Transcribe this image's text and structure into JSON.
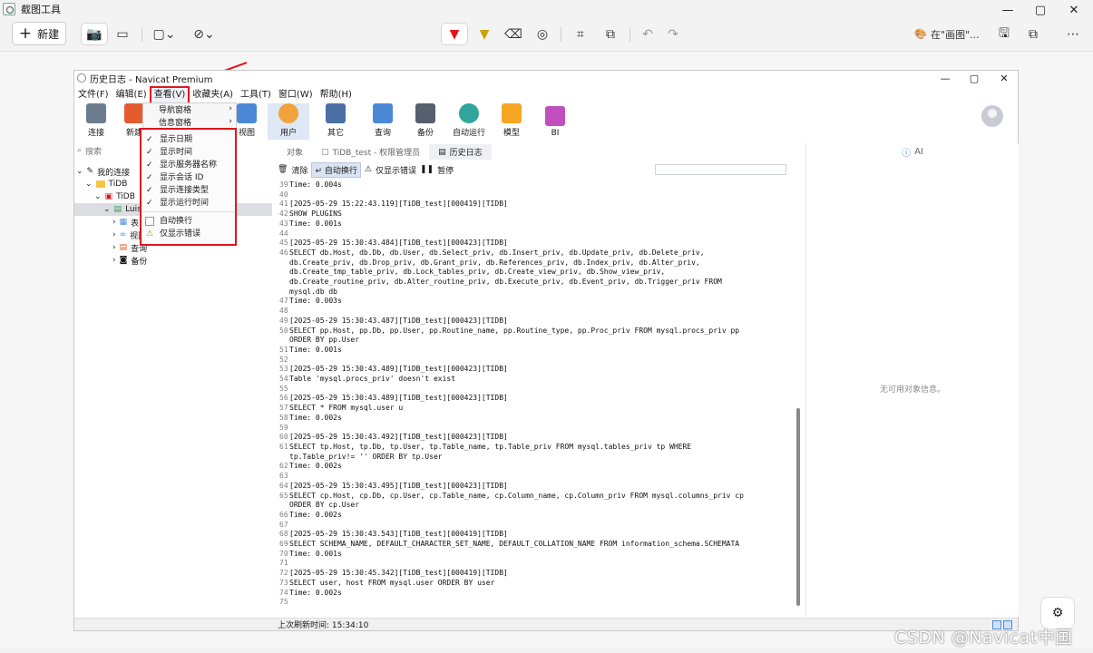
{
  "snip": {
    "title": "截图工具",
    "new_label": "新建",
    "open_in": "在\"画图\"...",
    "controls": {
      "minimize": "—",
      "maximize": "▢",
      "close": "✕"
    }
  },
  "navicat": {
    "title": "历史日志 - Navicat Premium",
    "controls": {
      "minimize": "—",
      "maximize": "▢",
      "close": "✕"
    },
    "menu": [
      "文件(F)",
      "编辑(E)",
      "查看(V)",
      "收藏夹(A)",
      "工具(T)",
      "窗口(W)",
      "帮助(H)"
    ],
    "ribbon": [
      {
        "label": "连接",
        "color": "#6b7c8f"
      },
      {
        "label": "新建",
        "color": "#e55b2f"
      },
      {
        "label": "视图",
        "color": "#4b89d6"
      },
      {
        "label": "用户",
        "color": "#f0a33a"
      },
      {
        "label": "其它",
        "color": "#4a6fa5"
      },
      {
        "label": "查询",
        "color": "#4b89d6"
      },
      {
        "label": "备份",
        "color": "#555f6e"
      },
      {
        "label": "自动运行",
        "color": "#2fa59b"
      },
      {
        "label": "模型",
        "color": "#f5a623"
      },
      {
        "label": "BI",
        "color": "#c14fbf"
      }
    ],
    "search_placeholder": "搜索",
    "tree": [
      {
        "label": "我的连接",
        "indent": 0
      },
      {
        "label": "TiDB",
        "indent": 1
      },
      {
        "label": "TiDB",
        "indent": 2
      },
      {
        "label": "Luis",
        "indent": 3
      },
      {
        "label": "表",
        "indent": 4
      },
      {
        "label": "视图",
        "indent": 4
      },
      {
        "label": "查询",
        "indent": 4
      },
      {
        "label": "备份",
        "indent": 4
      }
    ],
    "tabs": [
      "对象",
      "TiDB_test - 权限管理员",
      "历史日志"
    ],
    "log_toolbar": {
      "clear": "清除",
      "autowrap": "自动换行",
      "errors_only": "仅显示错误",
      "pause": "暂停"
    },
    "log_lines": [
      {
        "n": "39",
        "t": "Time: 0.004s"
      },
      {
        "n": "40",
        "t": ""
      },
      {
        "n": "41",
        "t": "[2025-05-29 15:22:43.119][TiDB_test][000419][TIDB]"
      },
      {
        "n": "42",
        "t": "SHOW PLUGINS"
      },
      {
        "n": "43",
        "t": "Time: 0.001s"
      },
      {
        "n": "44",
        "t": ""
      },
      {
        "n": "45",
        "t": "[2025-05-29 15:30:43.484][TiDB_test][000423][TIDB]"
      },
      {
        "n": "46",
        "t": "SELECT db.Host, db.Db, db.User, db.Select_priv, db.Insert_priv, db.Update_priv, db.Delete_priv,"
      },
      {
        "n": "",
        "t": "db.Create_priv, db.Drop_priv, db.Grant_priv, db.References_priv, db.Index_priv, db.Alter_priv,"
      },
      {
        "n": "",
        "t": "db.Create_tmp_table_priv, db.Lock_tables_priv, db.Create_view_priv, db.Show_view_priv,"
      },
      {
        "n": "",
        "t": "db.Create_routine_priv, db.Alter_routine_priv, db.Execute_priv, db.Event_priv, db.Trigger_priv FROM"
      },
      {
        "n": "",
        "t": "mysql.db db"
      },
      {
        "n": "47",
        "t": "Time: 0.003s"
      },
      {
        "n": "48",
        "t": ""
      },
      {
        "n": "49",
        "t": "[2025-05-29 15:30:43.487][TiDB_test][000423][TIDB]"
      },
      {
        "n": "50",
        "t": "SELECT pp.Host, pp.Db, pp.User, pp.Routine_name, pp.Routine_type, pp.Proc_priv FROM mysql.procs_priv pp"
      },
      {
        "n": "",
        "t": "ORDER BY pp.User"
      },
      {
        "n": "51",
        "t": "Time: 0.001s"
      },
      {
        "n": "52",
        "t": ""
      },
      {
        "n": "53",
        "t": "[2025-05-29 15:30:43.489][TiDB_test][000423][TIDB]"
      },
      {
        "n": "54",
        "t": "Table 'mysql.procs_priv' doesn't exist"
      },
      {
        "n": "55",
        "t": ""
      },
      {
        "n": "56",
        "t": "[2025-05-29 15:30:43.489][TiDB_test][000423][TIDB]"
      },
      {
        "n": "57",
        "t": "SELECT * FROM mysql.user u"
      },
      {
        "n": "58",
        "t": "Time: 0.002s"
      },
      {
        "n": "59",
        "t": ""
      },
      {
        "n": "60",
        "t": "[2025-05-29 15:30:43.492][TiDB_test][000423][TIDB]"
      },
      {
        "n": "61",
        "t": "SELECT tp.Host, tp.Db, tp.User, tp.Table_name, tp.Table_priv FROM mysql.tables_priv tp WHERE"
      },
      {
        "n": "",
        "t": "tp.Table_priv!= '' ORDER BY tp.User"
      },
      {
        "n": "62",
        "t": "Time: 0.002s"
      },
      {
        "n": "63",
        "t": ""
      },
      {
        "n": "64",
        "t": "[2025-05-29 15:30:43.495][TiDB_test][000423][TIDB]"
      },
      {
        "n": "65",
        "t": "SELECT cp.Host, cp.Db, cp.User, cp.Table_name, cp.Column_name, cp.Column_priv FROM mysql.columns_priv cp"
      },
      {
        "n": "",
        "t": "ORDER BY cp.User"
      },
      {
        "n": "66",
        "t": "Time: 0.002s"
      },
      {
        "n": "67",
        "t": ""
      },
      {
        "n": "68",
        "t": "[2025-05-29 15:30:43.543][TiDB_test][000419][TIDB]"
      },
      {
        "n": "69",
        "t": "SELECT SCHEMA_NAME, DEFAULT_CHARACTER_SET_NAME, DEFAULT_COLLATION_NAME FROM information_schema.SCHEMATA"
      },
      {
        "n": "70",
        "t": "Time: 0.001s"
      },
      {
        "n": "71",
        "t": ""
      },
      {
        "n": "72",
        "t": "[2025-05-29 15:30:45.342][TiDB_test][000419][TIDB]"
      },
      {
        "n": "73",
        "t": "SELECT user, host FROM mysql.user ORDER BY user"
      },
      {
        "n": "74",
        "t": "Time: 0.002s"
      },
      {
        "n": "75",
        "t": ""
      }
    ],
    "right_header": "AI",
    "right_empty": "无可用对象信息。",
    "status": "上次刷新时间: 15:34:10",
    "view_menu": {
      "submenus": [
        "导航窗格",
        "信息窗格"
      ],
      "checked": [
        "显示日期",
        "显示时间",
        "显示服务器名称",
        "显示会话 ID",
        "显示连接类型",
        "显示运行时间"
      ],
      "others": [
        "自动换行",
        "仅显示错误"
      ]
    }
  },
  "watermark": "CSDN @Navicat中国"
}
